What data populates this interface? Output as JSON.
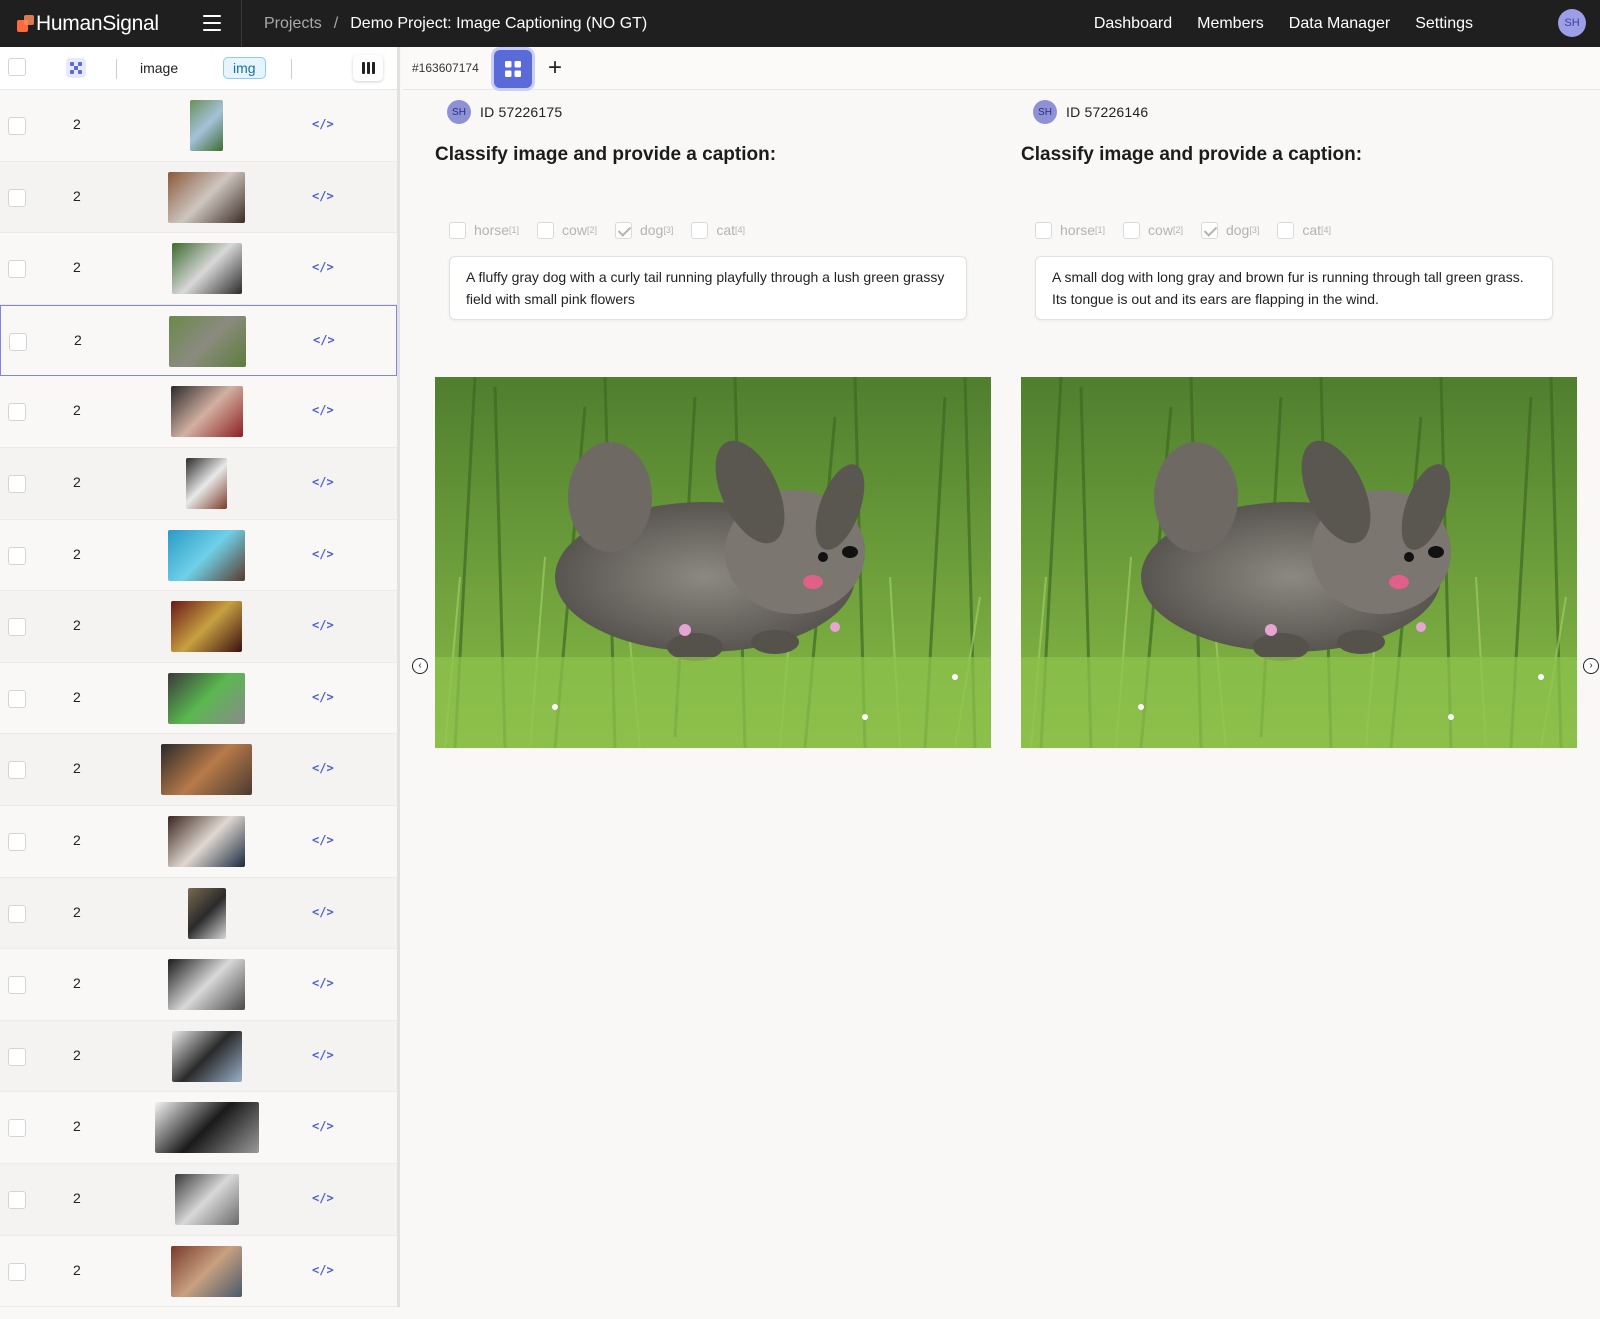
{
  "app": {
    "brand": "HumanSignal",
    "breadcrumb": {
      "projects": "Projects",
      "separator": "/",
      "current": "Demo Project: Image Captioning (NO GT)"
    },
    "nav": [
      "Dashboard",
      "Members",
      "Data Manager",
      "Settings"
    ],
    "user_initials": "SH"
  },
  "grid": {
    "header": {
      "image_col": "image",
      "img_badge": "img"
    },
    "rows": [
      {
        "count": "2",
        "code": "</>",
        "selected": false
      },
      {
        "count": "2",
        "code": "</>",
        "selected": false
      },
      {
        "count": "2",
        "code": "</>",
        "selected": false
      },
      {
        "count": "2",
        "code": "</>",
        "selected": true
      },
      {
        "count": "2",
        "code": "</>",
        "selected": false
      },
      {
        "count": "2",
        "code": "</>",
        "selected": false
      },
      {
        "count": "2",
        "code": "</>",
        "selected": false
      },
      {
        "count": "2",
        "code": "</>",
        "selected": false
      },
      {
        "count": "2",
        "code": "</>",
        "selected": false
      },
      {
        "count": "2",
        "code": "</>",
        "selected": false
      },
      {
        "count": "2",
        "code": "</>",
        "selected": false
      },
      {
        "count": "2",
        "code": "</>",
        "selected": false
      },
      {
        "count": "2",
        "code": "</>",
        "selected": false
      },
      {
        "count": "2",
        "code": "</>",
        "selected": false
      },
      {
        "count": "2",
        "code": "</>",
        "selected": false
      },
      {
        "count": "2",
        "code": "</>",
        "selected": false
      },
      {
        "count": "2",
        "code": "</>",
        "selected": false
      }
    ]
  },
  "task": {
    "id": "#163607174"
  },
  "annotations": [
    {
      "user_initials": "SH",
      "id": "ID 57226175",
      "question": "Classify image and provide a caption:",
      "choices": [
        {
          "label": "horse",
          "hotkey": "[1]",
          "checked": false
        },
        {
          "label": "cow",
          "hotkey": "[2]",
          "checked": false
        },
        {
          "label": "dog",
          "hotkey": "[3]",
          "checked": true
        },
        {
          "label": "cat",
          "hotkey": "[4]",
          "checked": false
        }
      ],
      "caption": "A fluffy gray dog with a curly tail running playfully through a lush green grassy field with small pink flowers"
    },
    {
      "user_initials": "SH",
      "id": "ID 57226146",
      "question": "Classify image and provide a caption:",
      "choices": [
        {
          "label": "horse",
          "hotkey": "[1]",
          "checked": false
        },
        {
          "label": "cow",
          "hotkey": "[2]",
          "checked": false
        },
        {
          "label": "dog",
          "hotkey": "[3]",
          "checked": true
        },
        {
          "label": "cat",
          "hotkey": "[4]",
          "checked": false
        }
      ],
      "caption": "A small dog with long gray and brown fur is running through tall green grass. Its tongue is out and its ears are flapping in the wind."
    }
  ],
  "colors": {
    "topbar": "#1f1f1f",
    "accent": "#5a6ad8",
    "badge_bg": "#e6f4fd"
  }
}
